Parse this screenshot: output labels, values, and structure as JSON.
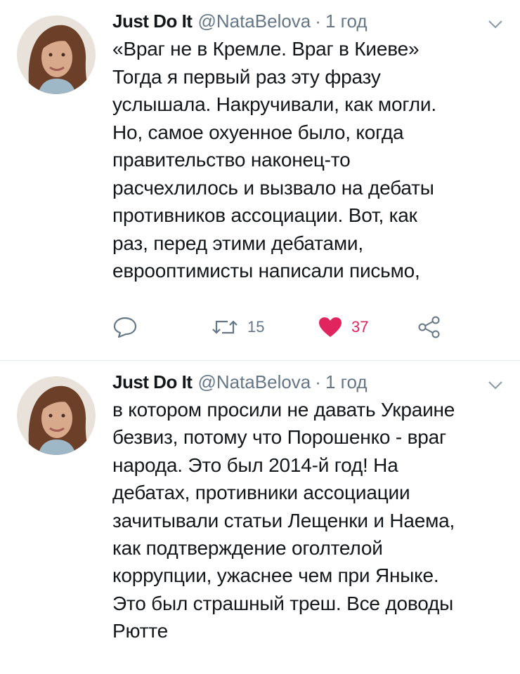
{
  "tweets": [
    {
      "name": "Just Do It",
      "handle": "@NataBelova",
      "separator": "·",
      "time": "1 год",
      "text": "«Враг не в Кремле. Враг в Киеве»\nТогда я первый раз эту фразу\nуслышала. Накручивали, как могли.\nНо, самое охуенное было, когда\nправительство наконец-то\nрасчехлилось и вызвало на дебаты\nпротивников ассоциации. Вот, как\nраз, перед этими дебатами,\nеврооптимисты написали письмо,",
      "actions": {
        "reply_icon": "reply-icon",
        "retweet_icon": "retweet-icon",
        "retweet_count": "15",
        "like_icon": "heart-filled-icon",
        "like_count": "37",
        "share_icon": "share-icon"
      }
    },
    {
      "name": "Just Do It",
      "handle": "@NataBelova",
      "separator": "·",
      "time": "1 год",
      "text": "в котором просили не давать Украине\nбезвиз, потому что Порошенко - враг\nнарода. Это был 2014-й год! На\nдебатах, противники ассоциации\nзачитывали статьи Лещенки и Наема,\nкак подтверждение оголтелой\nкоррупции, ужаснее чем при Яныке.\nЭто был страшный треш. Все доводы\nРютте"
    }
  ],
  "colors": {
    "text": "#14171a",
    "secondary": "#657786",
    "like": "#e0245e",
    "divider": "#e6ecf0"
  }
}
